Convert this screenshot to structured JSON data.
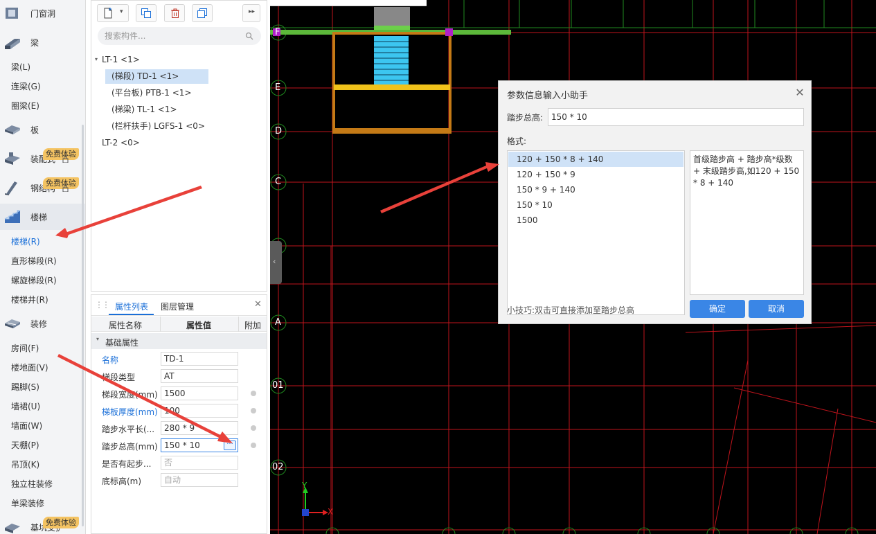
{
  "sidebar": {
    "categories": [
      {
        "label": "门窗洞"
      },
      {
        "label": "梁"
      },
      {
        "label": "板"
      },
      {
        "label": "装配式"
      },
      {
        "label": "钢结构"
      },
      {
        "label": "楼梯"
      },
      {
        "label": "装修"
      },
      {
        "label": "基坑支护"
      }
    ],
    "beam_items": [
      "梁(L)",
      "连梁(G)",
      "圈梁(E)"
    ],
    "stair_items": [
      "楼梯(R)",
      "直形梯段(R)",
      "螺旋梯段(R)",
      "楼梯井(R)"
    ],
    "decor_items": [
      "房间(F)",
      "楼地面(V)",
      "踢脚(S)",
      "墙裙(U)",
      "墙面(W)",
      "天棚(P)",
      "吊顶(K)",
      "独立柱装修",
      "单梁装修"
    ],
    "badge": "免费体验"
  },
  "components": {
    "search_placeholder": "搜索构件...",
    "tree": {
      "lt1": "LT-1 <1>",
      "td1": "(梯段) TD-1 <1>",
      "ptb1": "(平台板) PTB-1 <1>",
      "tl1": "(梯梁) TL-1 <1>",
      "lgfs1": "(栏杆扶手) LGFS-1 <0>",
      "lt2": "LT-2 <0>"
    }
  },
  "properties": {
    "tab_active": "属性列表",
    "tab_other": "图层管理",
    "col_name": "属性名称",
    "col_value": "属性值",
    "col_extra": "附加",
    "group": "基础属性",
    "rows": [
      {
        "name": "名称",
        "value": "TD-1"
      },
      {
        "name": "梯段类型",
        "value": "AT"
      },
      {
        "name": "梯段宽度(mm)",
        "value": "1500"
      },
      {
        "name": "梯板厚度(mm)",
        "value": "100"
      },
      {
        "name": "踏步水平长(...",
        "value": "280 * 9"
      },
      {
        "name": "踏步总高(mm)",
        "value": "150 * 10"
      },
      {
        "name": "是否有起步...",
        "value": "否"
      },
      {
        "name": "底标高(m)",
        "value": "自动"
      }
    ]
  },
  "canvas": {
    "axis_labels": [
      "F",
      "E",
      "D",
      "C",
      "B",
      "A",
      "01",
      "02"
    ],
    "ucs_x": "X",
    "ucs_y": "Y"
  },
  "dialog": {
    "title": "参数信息输入小助手",
    "total_label": "踏步总高:",
    "total_value": "150 * 10",
    "format_label": "格式:",
    "formats": [
      "120 + 150 * 8 + 140",
      "120 + 150 * 9",
      "150 * 9 + 140",
      "150 * 10",
      "1500"
    ],
    "description": "首级踏步高 + 踏步高*级数 + 末级踏步高,如120 + 150 * 8 + 140",
    "tip": "小技巧:双击可直接添加至踏步总高",
    "ok": "确定",
    "cancel": "取消"
  }
}
